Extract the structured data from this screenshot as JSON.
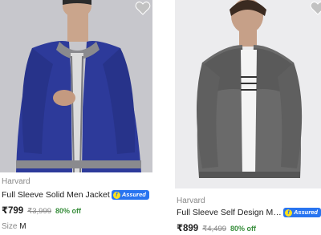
{
  "products": [
    {
      "brand": "Harvard",
      "title": "Full Sleeve Solid Men Jacket",
      "assured_label": "Assured",
      "price": "₹799",
      "mrp": "₹3,999",
      "discount": "80% off",
      "size_label": "Size",
      "size_value": "M",
      "jacket_color": "#2d3a9a"
    },
    {
      "brand": "Harvard",
      "title": "Full Sleeve Self Design Men...",
      "assured_label": "Assured",
      "price": "₹899",
      "mrp": "₹4,499",
      "discount": "80% off",
      "jacket_color": "#6a6a6a"
    }
  ],
  "colors": {
    "assured_blue": "#2874f0",
    "discount_green": "#388e3c",
    "muted_text": "#878787"
  },
  "icons": [
    "heart-icon",
    "flipkart-f-icon"
  ]
}
